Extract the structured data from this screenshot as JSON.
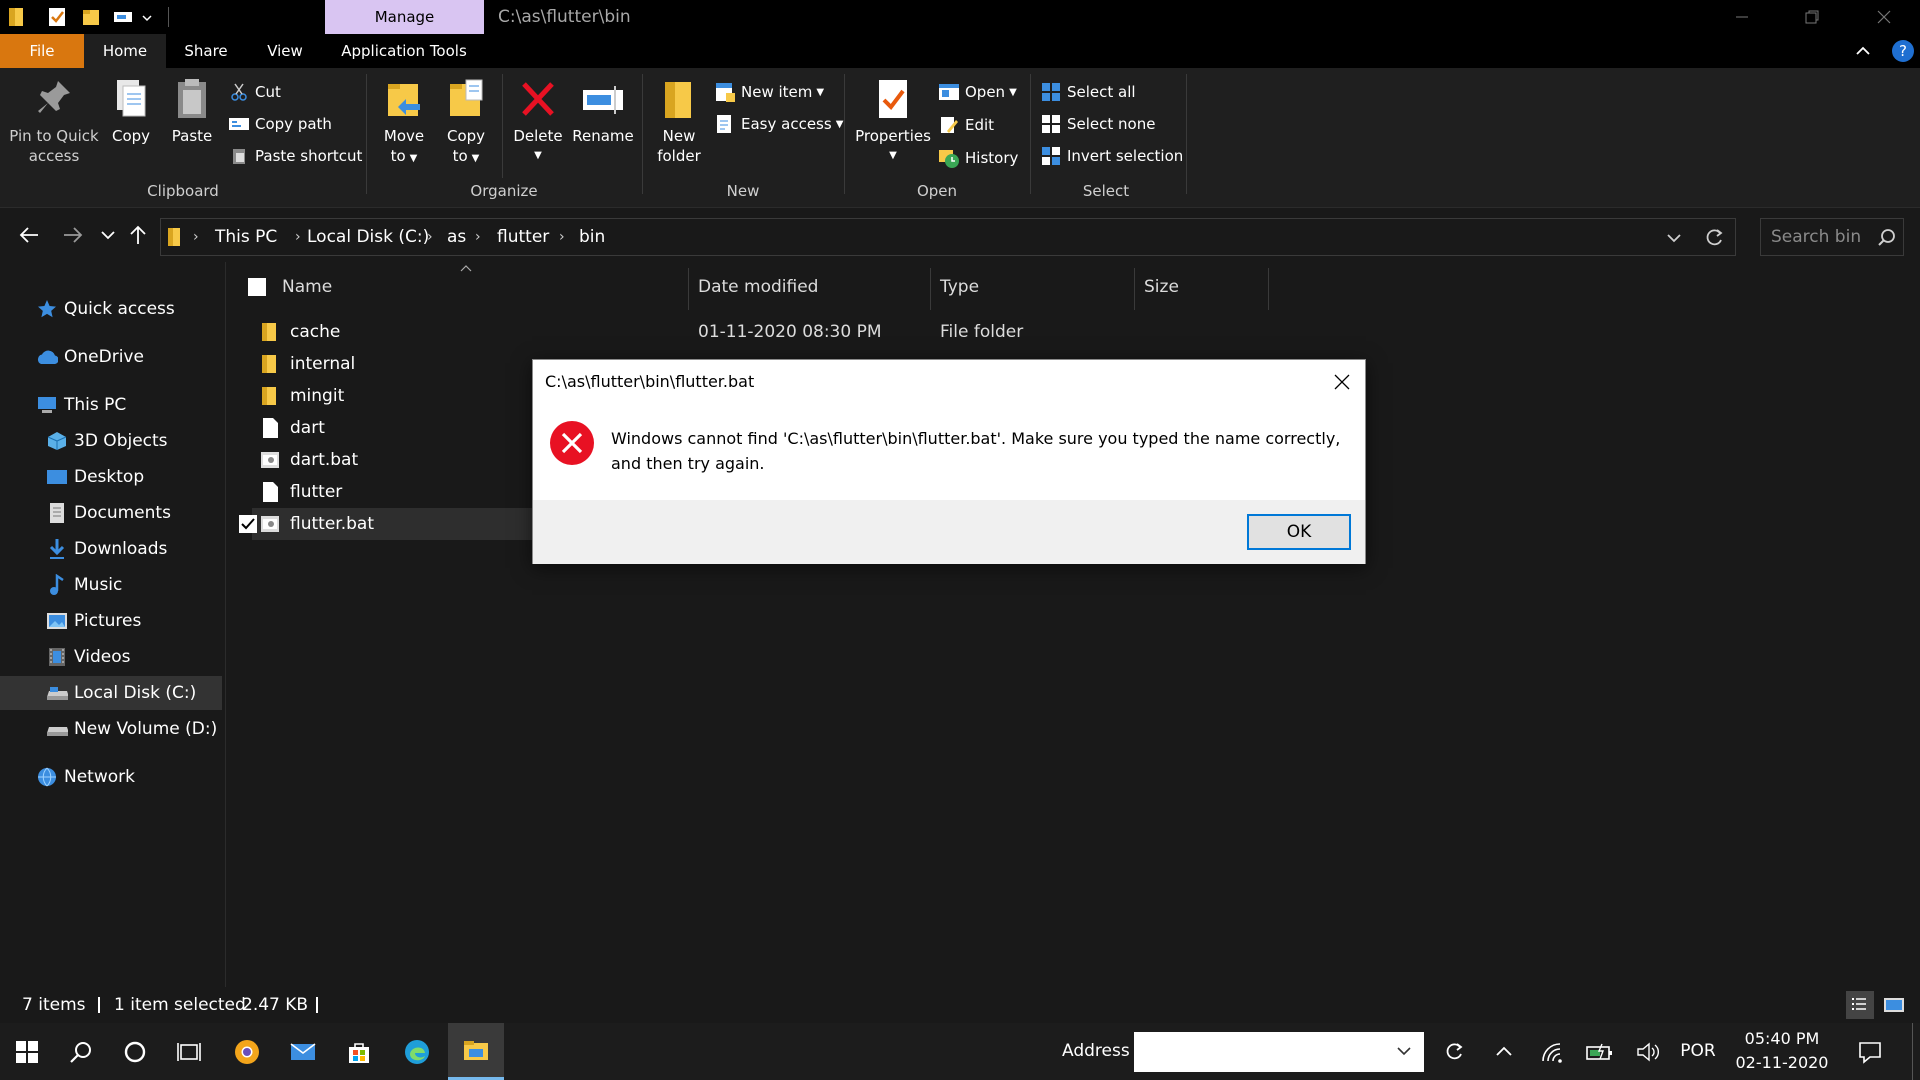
{
  "titlebar": {
    "contextual_tab": "Manage",
    "path": "C:\\as\\flutter\\bin"
  },
  "ribbon_tabs": [
    "File",
    "Home",
    "Share",
    "View",
    "Application Tools"
  ],
  "ribbon": {
    "clipboard": {
      "pin": [
        "Pin to Quick",
        "access"
      ],
      "copy": "Copy",
      "paste": "Paste",
      "cut": "Cut",
      "copy_path": "Copy path",
      "paste_shortcut": "Paste shortcut",
      "label": "Clipboard"
    },
    "organize": {
      "move_to": [
        "Move",
        "to"
      ],
      "copy_to": [
        "Copy",
        "to"
      ],
      "delete": "Delete",
      "rename": "Rename",
      "label": "Organize"
    },
    "new": {
      "new_folder": [
        "New",
        "folder"
      ],
      "new_item": "New item",
      "easy_access": "Easy access",
      "label": "New"
    },
    "open": {
      "properties": "Properties",
      "open": "Open",
      "edit": "Edit",
      "history": "History",
      "label": "Open"
    },
    "select": {
      "select_all": "Select all",
      "select_none": "Select none",
      "invert": "Invert selection",
      "label": "Select"
    }
  },
  "address": {
    "crumbs": [
      "This PC",
      "Local Disk (C:)",
      "as",
      "flutter",
      "bin"
    ],
    "search_placeholder": "Search bin"
  },
  "sidebar": {
    "items": [
      "Quick access",
      "OneDrive",
      "This PC",
      "3D Objects",
      "Desktop",
      "Documents",
      "Downloads",
      "Music",
      "Pictures",
      "Videos",
      "Local Disk (C:)",
      "New Volume (D:)",
      "Network"
    ]
  },
  "filelist": {
    "columns": [
      "Name",
      "Date modified",
      "Type",
      "Size"
    ],
    "rows": [
      {
        "name": "cache",
        "date": "01-11-2020 08:30 PM",
        "type": "File folder"
      },
      {
        "name": "internal"
      },
      {
        "name": "mingit"
      },
      {
        "name": "dart"
      },
      {
        "name": "dart.bat"
      },
      {
        "name": "flutter"
      },
      {
        "name": "flutter.bat"
      }
    ]
  },
  "status": {
    "items": "7 items",
    "selected": "1 item selected",
    "size": "2.47 KB"
  },
  "taskbar": {
    "address_label": "Address",
    "language": "POR",
    "time": "05:40 PM",
    "date": "02-11-2020"
  },
  "dialog": {
    "title": "C:\\as\\flutter\\bin\\flutter.bat",
    "message": "Windows cannot find 'C:\\as\\flutter\\bin\\flutter.bat'. Make sure you typed the name correctly, and then try again.",
    "ok": "OK"
  },
  "colors": {
    "file_tab": "#d9770f",
    "manage_tab": "#d9c5f2",
    "folder": "#f7c948",
    "accent": "#0078d7",
    "error": "#e81123"
  }
}
